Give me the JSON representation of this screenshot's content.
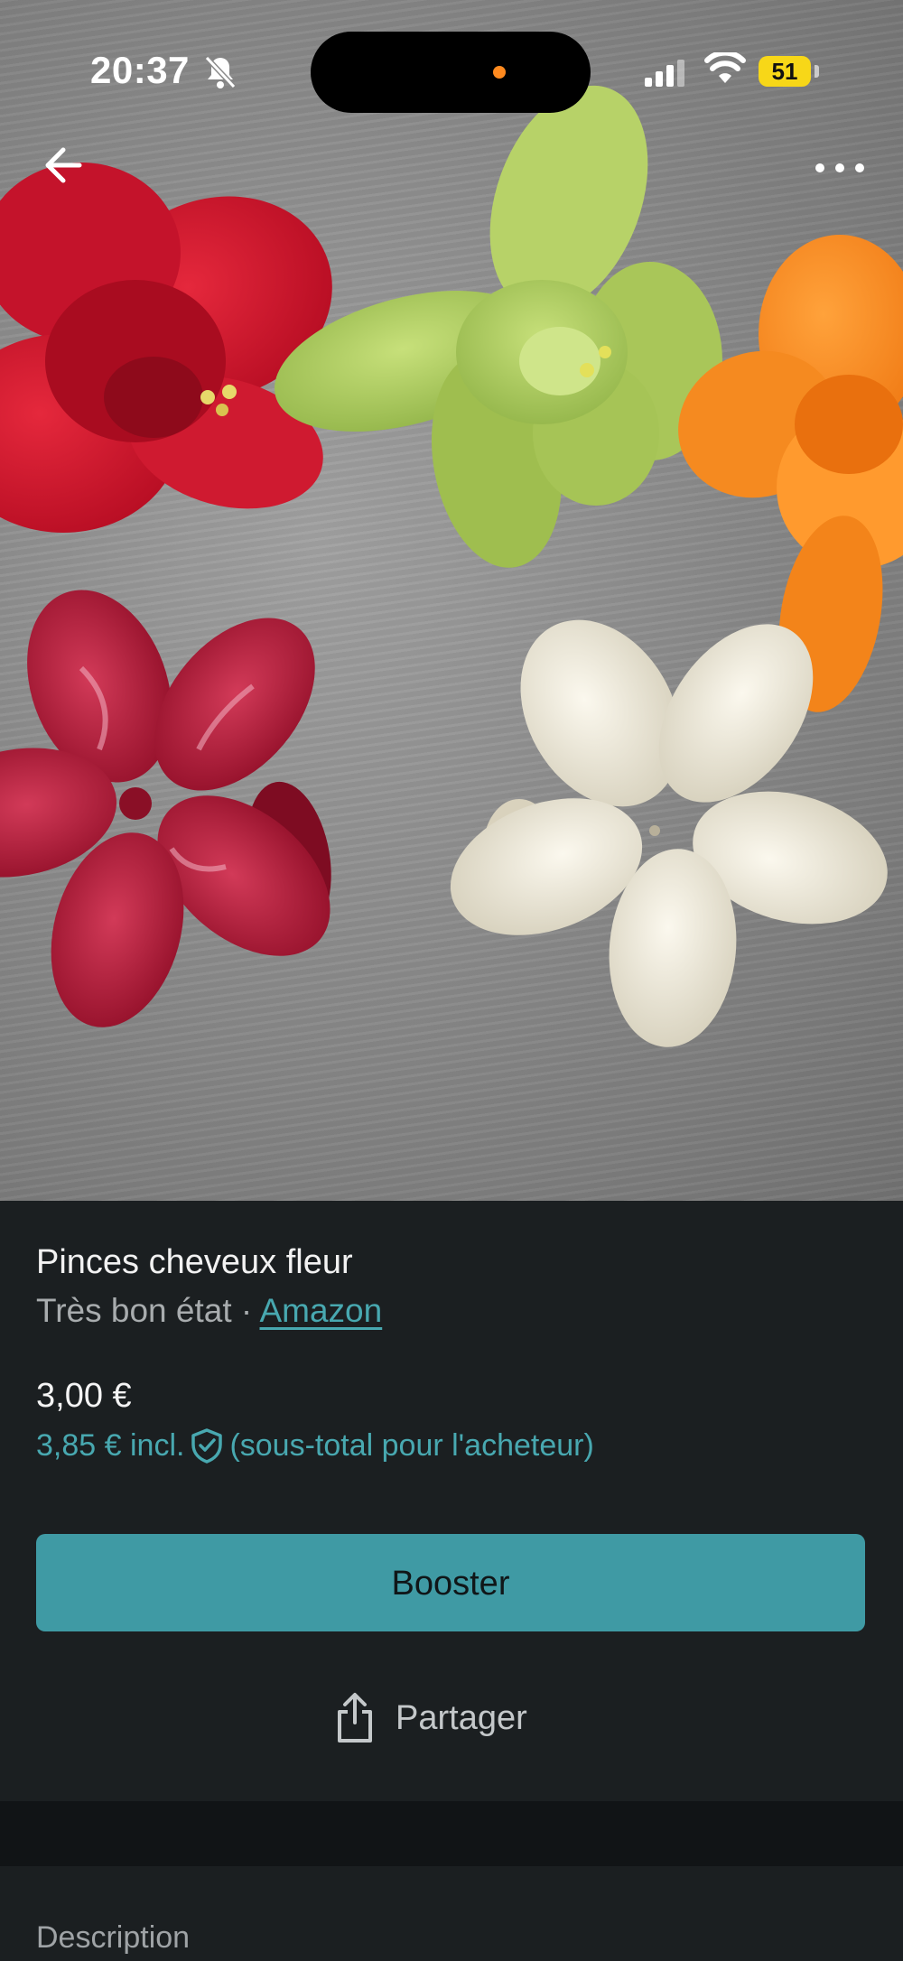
{
  "status_bar": {
    "time": "20:37",
    "battery_level": "51",
    "icons": [
      "bell-off-icon",
      "signal-icon",
      "wifi-icon",
      "battery-icon"
    ],
    "battery_color": "#f7d718"
  },
  "top_nav": {
    "icons": [
      "back-arrow-icon",
      "more-options-icon"
    ]
  },
  "product": {
    "title": "Pinces cheveux fleur",
    "condition": "Très bon état",
    "separator": " · ",
    "brand": "Amazon",
    "price": "3,00 €",
    "price_incl": "3,85 € incl.",
    "price_incl_note": "(sous-total pour l'acheteur)"
  },
  "actions": {
    "booster_label": "Booster",
    "share_label": "Partager"
  },
  "description": {
    "heading": "Description"
  },
  "colors": {
    "accent": "#3f9aa4",
    "link": "#48a8b0",
    "background": "#1b1f21"
  }
}
